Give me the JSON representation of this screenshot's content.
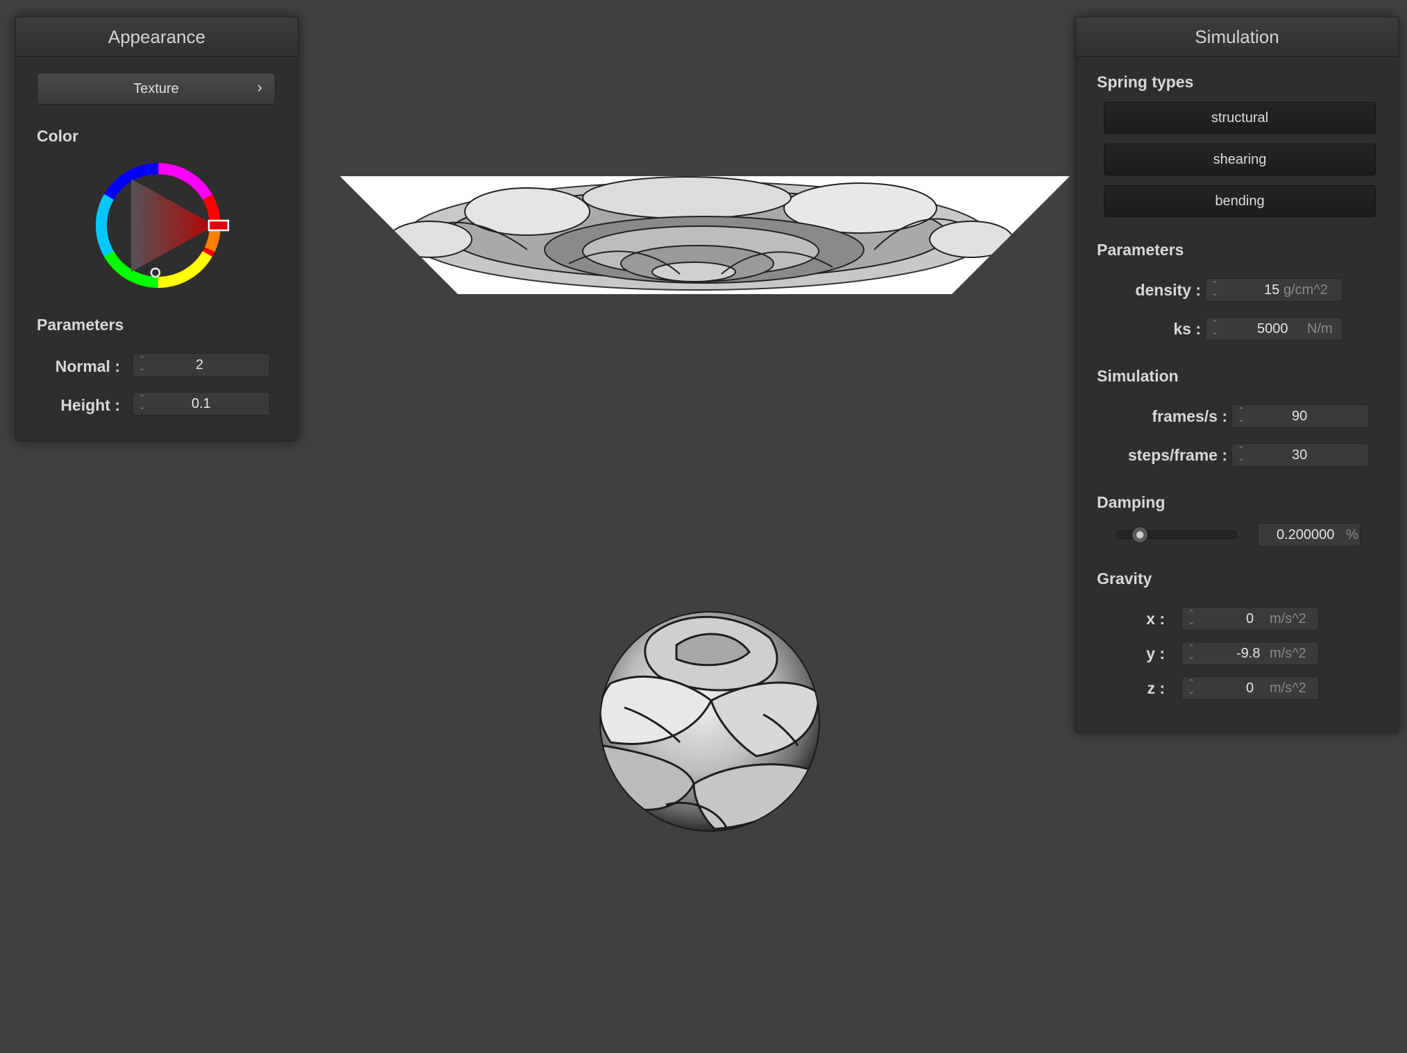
{
  "appearance": {
    "title": "Appearance",
    "texture_button": "Texture",
    "texture_chevron": "›",
    "color_label": "Color",
    "parameters_label": "Parameters",
    "normal_label": "Normal :",
    "normal_value": "2",
    "height_label": "Height :",
    "height_value": "0.1",
    "color_value": "#c00000"
  },
  "simulation": {
    "title": "Simulation",
    "spring_types_label": "Spring types",
    "spring_buttons": [
      "structural",
      "shearing",
      "bending"
    ],
    "parameters_label": "Parameters",
    "density_label": "density :",
    "density_value": "15",
    "density_unit": "g/cm^2",
    "ks_label": "ks :",
    "ks_value": "5000",
    "ks_unit": "N/m",
    "simulation_label": "Simulation",
    "fps_label": "frames/s :",
    "fps_value": "90",
    "steps_label": "steps/frame :",
    "steps_value": "30",
    "damping_label": "Damping",
    "damping_value": "0.200000",
    "damping_unit": "%",
    "damping_level": 0.2,
    "gravity_label": "Gravity",
    "gx_label": "x :",
    "gx_value": "0",
    "gy_label": "y :",
    "gy_value": "-9.8",
    "gz_label": "z :",
    "gz_value": "0",
    "gravity_unit": "m/s^2"
  },
  "scene": {
    "objects": [
      "rose-textured-cloth",
      "rose-textured-sphere"
    ]
  }
}
